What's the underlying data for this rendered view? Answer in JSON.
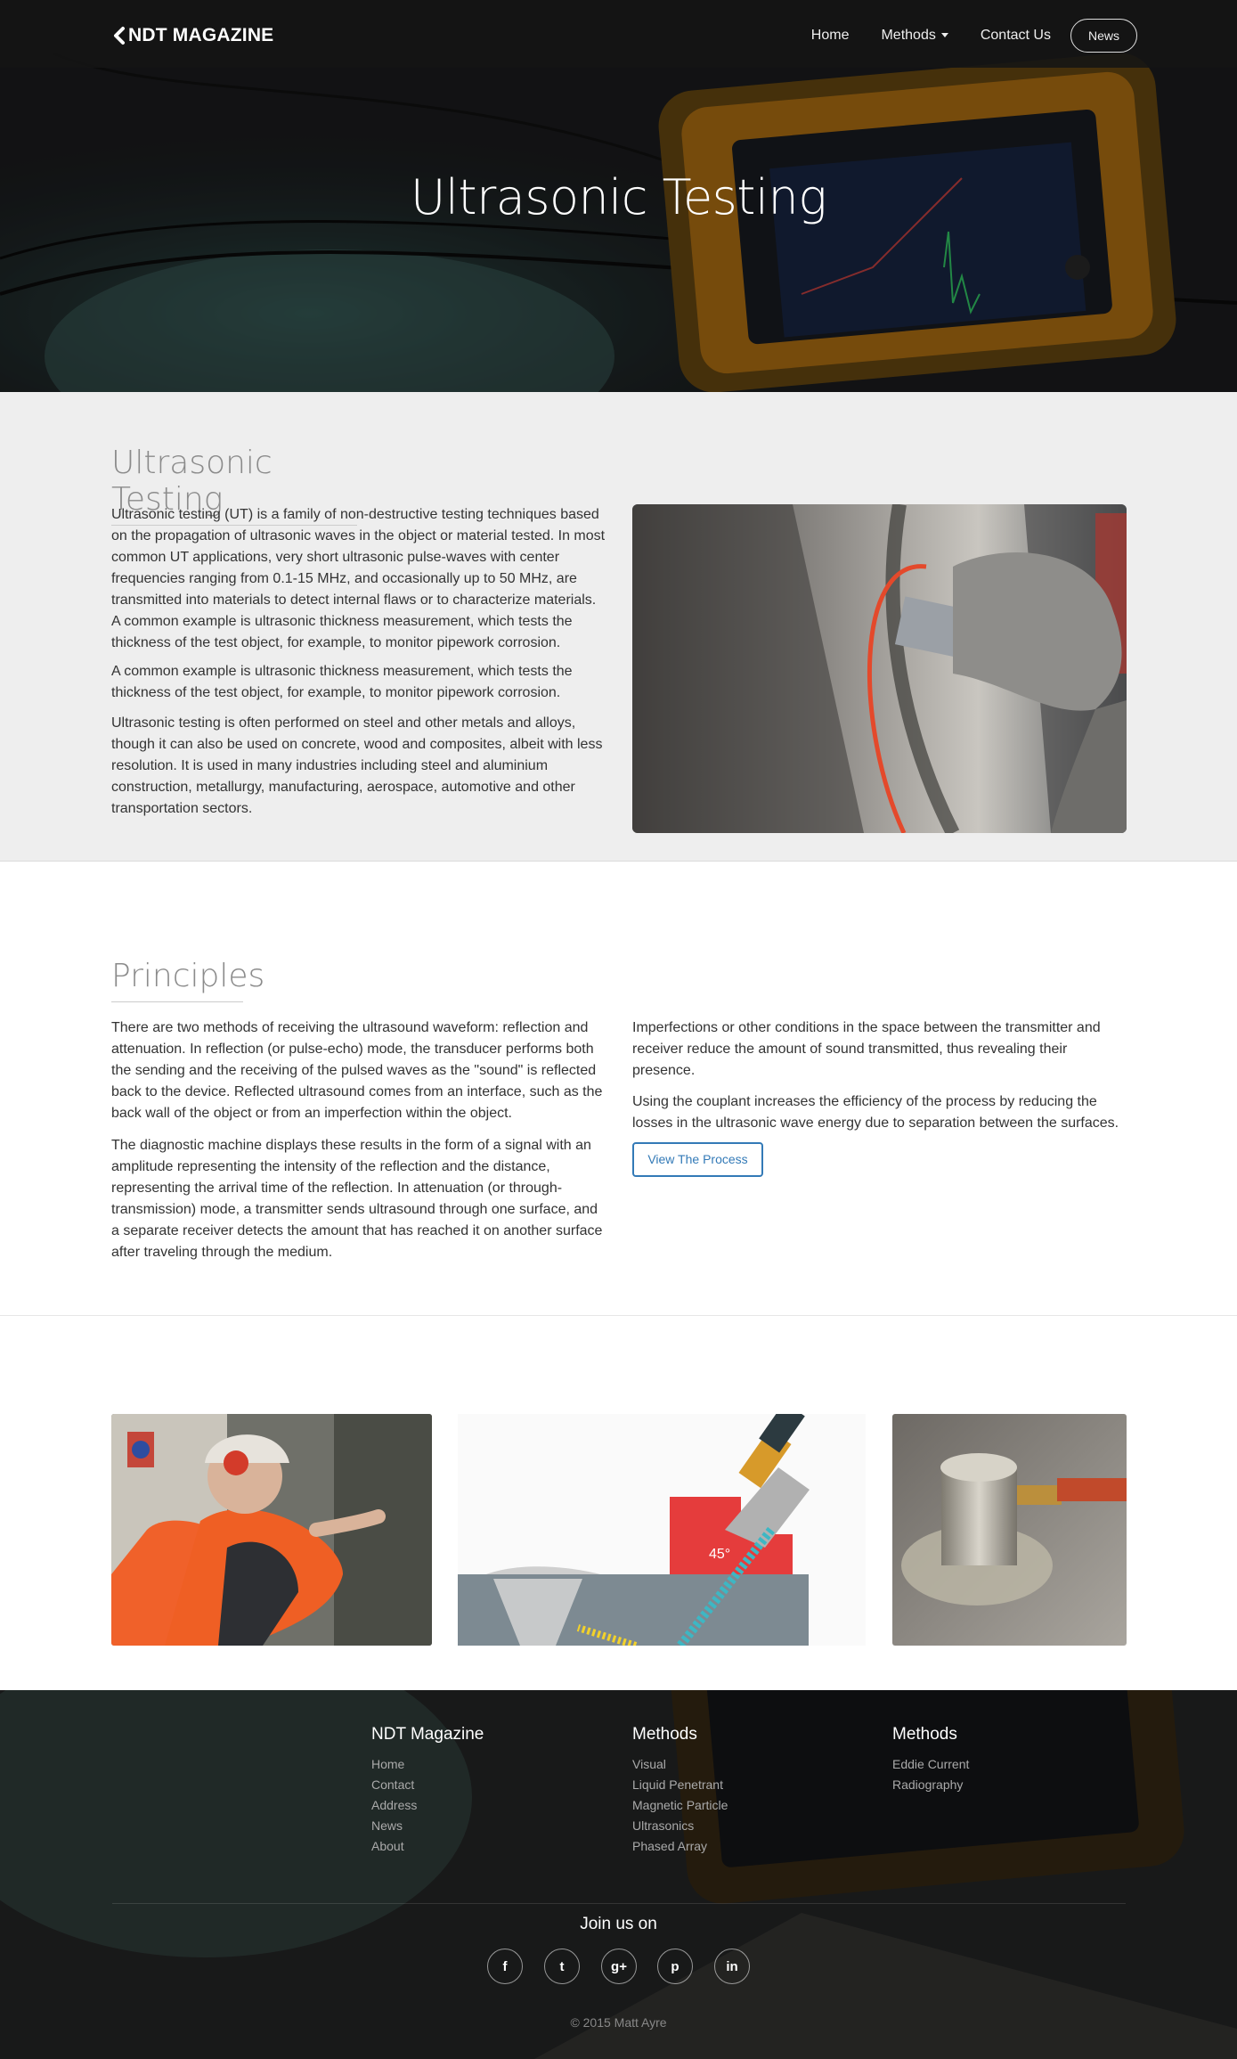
{
  "navbar": {
    "brand": "NDT MAGAZINE",
    "links": [
      "Home",
      "Methods",
      "Contact Us"
    ],
    "news_button": "News"
  },
  "hero": {
    "title": "Ultrasonic Testing"
  },
  "intro": {
    "title": "Ultrasonic Testing",
    "paragraphs": [
      "Ultrasonic testing (UT) is a family of non-destructive testing techniques based on the propagation of ultrasonic waves in the object or material tested. In most common UT applications, very short ultrasonic pulse-waves with center frequencies ranging from 0.1-15 MHz, and occasionally up to 50 MHz, are transmitted into materials to detect internal flaws or to characterize materials. A common example is ultrasonic thickness measurement, which tests the thickness of the test object, for example, to monitor pipework corrosion.",
      "A common example is ultrasonic thickness measurement, which tests the thickness of the test object, for example, to monitor pipework corrosion.",
      "Ultrasonic testing is often performed on steel and other metals and alloys, though it can also be used on concrete, wood and composites, albeit with less resolution. It is used in many industries including steel and aluminium construction, metallurgy, manufacturing, aerospace, automotive and other transportation sectors."
    ]
  },
  "principles": {
    "title": "Principles",
    "left_paragraphs": [
      "There are two methods of receiving the ultrasound waveform: reflection and attenuation. In reflection (or pulse-echo) mode, the transducer performs both the sending and the receiving of the pulsed waves as the \"sound\" is reflected back to the device. Reflected ultrasound comes from an interface, such as the back wall of the object or from an imperfection within the object.",
      "The diagnostic machine displays these results in the form of a signal with an amplitude representing the intensity of the reflection and the distance, representing the arrival time of the reflection. In attenuation (or through-transmission) mode, a transmitter sends ultrasound through one surface, and a separate receiver detects the amount that has reached it on another surface after traveling through the medium."
    ],
    "right_paragraphs": [
      "Imperfections or other conditions in the space between the transmitter and receiver reduce the amount of sound transmitted, thus revealing their presence.",
      "Using the couplant increases the efficiency of the process by reducing the losses in the ultrasonic wave energy due to separation between the surfaces."
    ],
    "button": "View The Process"
  },
  "gallery": {
    "angle_label": "45°"
  },
  "footer": {
    "col1": {
      "title": "NDT Magazine",
      "links": [
        "Home",
        "Contact",
        "Address",
        "News",
        "About"
      ]
    },
    "col2": {
      "title": "Methods",
      "links": [
        "Visual",
        "Liquid Penetrant",
        "Magnetic Particle",
        "Ultrasonics",
        "Phased Array"
      ]
    },
    "col3": {
      "title": "Methods",
      "links": [
        "Eddie Current",
        "Radiography"
      ]
    },
    "join": "Join us on",
    "social_icons": [
      {
        "name": "facebook-icon",
        "glyph": "f"
      },
      {
        "name": "twitter-icon",
        "glyph": "t"
      },
      {
        "name": "google-plus-icon",
        "glyph": "g+"
      },
      {
        "name": "pinterest-icon",
        "glyph": "p"
      },
      {
        "name": "linkedin-icon",
        "glyph": "in"
      }
    ],
    "copyright": "© 2015 Matt Ayre"
  },
  "colors": {
    "accent": "#337ab7",
    "nav_bg": "#141414",
    "section_bg": "#eeeeee",
    "footer_bg": "#2c2d2d"
  }
}
